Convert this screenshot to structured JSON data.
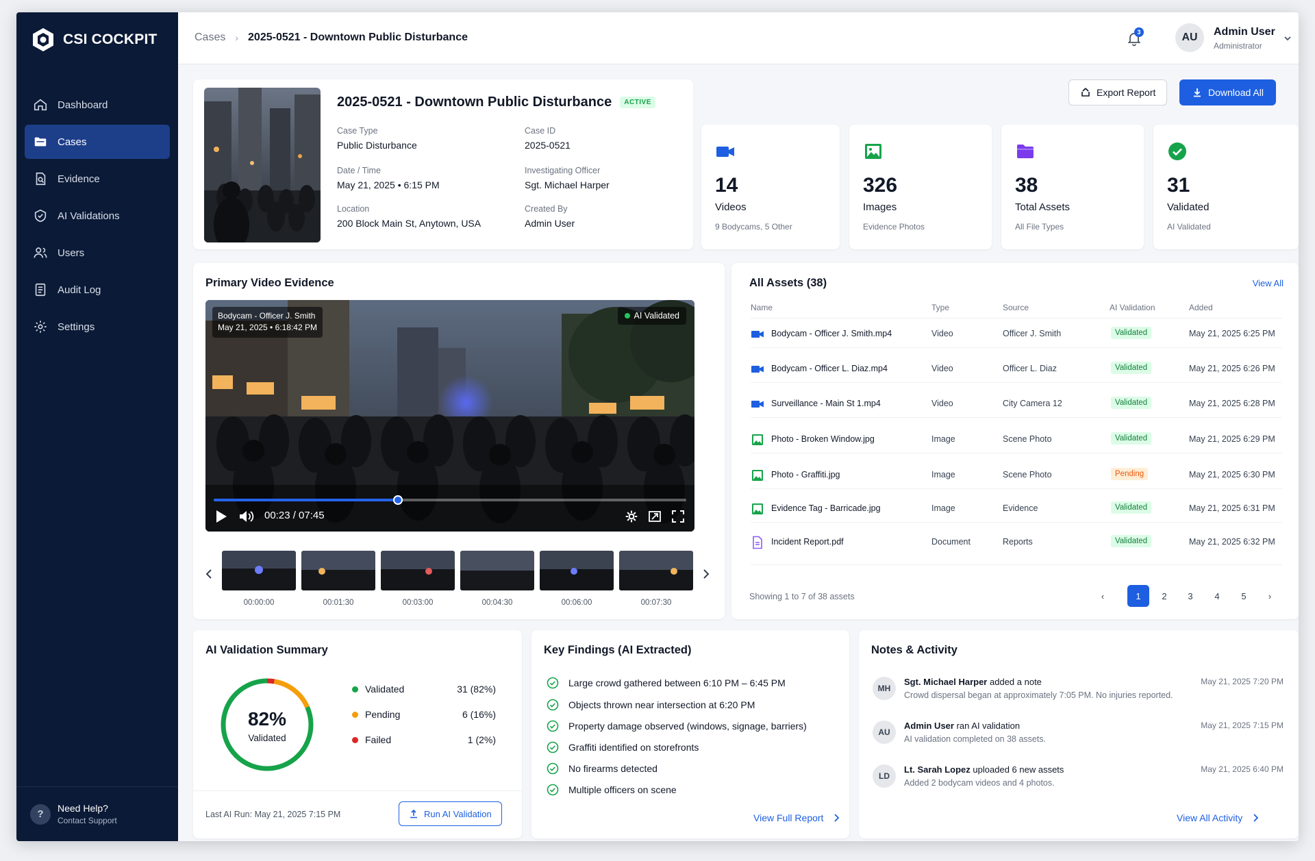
{
  "brand": {
    "name": "CSI COCKPIT"
  },
  "sidebar": {
    "items": [
      {
        "label": "Dashboard",
        "icon": "home-icon"
      },
      {
        "label": "Cases",
        "icon": "folder-icon",
        "active": true
      },
      {
        "label": "Evidence",
        "icon": "evidence-icon"
      },
      {
        "label": "AI Validations",
        "icon": "ai-validation-icon"
      },
      {
        "label": "Users",
        "icon": "users-icon"
      },
      {
        "label": "Audit Log",
        "icon": "document-icon"
      },
      {
        "label": "Settings",
        "icon": "gear-icon"
      }
    ],
    "help_title": "Need Help?",
    "help_sub": "Contact Support",
    "help_glyph": "?"
  },
  "header": {
    "crumb_root": "Cases",
    "crumb_sep": "›",
    "crumb_current": "2025-0521 - Downtown Public Disturbance",
    "notifications": "3",
    "user_initials": "AU",
    "user_name": "Admin User",
    "user_role": "Administrator"
  },
  "case": {
    "title": "2025-0521 - Downtown Public Disturbance",
    "status": "ACTIVE",
    "fields": {
      "case_type_label": "Case Type",
      "case_type": "Public Disturbance",
      "case_id_label": "Case ID",
      "case_id": "2025-0521",
      "datetime_label": "Date / Time",
      "datetime": "May 21, 2025  •  6:15 PM",
      "officer_label": "Investigating Officer",
      "officer": "Sgt. Michael Harper",
      "location_label": "Location",
      "location": "200 Block Main St, Anytown, USA",
      "created_label": "Created By",
      "created": "Admin User"
    }
  },
  "actions": {
    "export": "Export Report",
    "download": "Download All"
  },
  "stats": [
    {
      "value": "14",
      "label": "Videos",
      "sub": "9 Bodycams, 5 Other",
      "icon": "video-camera-icon",
      "color": "#1d5fe0"
    },
    {
      "value": "326",
      "label": "Images",
      "sub": "Evidence Photos",
      "icon": "image-icon",
      "color": "#16a34a"
    },
    {
      "value": "38",
      "label": "Total Assets",
      "sub": "All File Types",
      "icon": "folder-icon",
      "color": "#7c3aed"
    },
    {
      "value": "31",
      "label": "Validated",
      "sub": "AI Validated",
      "icon": "check-circle-icon",
      "color": "#16a34a"
    }
  ],
  "video": {
    "title": "Primary Video Evidence",
    "source": "Bodycam - Officer J. Smith",
    "timestamp": "May 21, 2025  •  6:18:42 PM",
    "ai_badge": "AI Validated",
    "time": "00:23 / 07:45",
    "progress": 0.39,
    "thumbs": [
      "00:00:00",
      "00:01:30",
      "00:03:00",
      "00:04:30",
      "00:06:00",
      "00:07:30"
    ]
  },
  "assets": {
    "title": "All Assets (38)",
    "view_all": "View All",
    "columns": [
      "Name",
      "Type",
      "Source",
      "AI Validation",
      "Added"
    ],
    "rows": [
      {
        "name": "Bodycam - Officer J. Smith.mp4",
        "type": "Video",
        "source": "Officer J. Smith",
        "status": "Validated",
        "added": "May 21, 2025 6:25 PM",
        "icon": "video-icon"
      },
      {
        "name": "Bodycam - Officer L. Diaz.mp4",
        "type": "Video",
        "source": "Officer L. Diaz",
        "status": "Validated",
        "added": "May 21, 2025 6:26 PM",
        "icon": "video-icon"
      },
      {
        "name": "Surveillance - Main St 1.mp4",
        "type": "Video",
        "source": "City Camera 12",
        "status": "Validated",
        "added": "May 21, 2025 6:28 PM",
        "icon": "video-icon"
      },
      {
        "name": "Photo - Broken Window.jpg",
        "type": "Image",
        "source": "Scene Photo",
        "status": "Validated",
        "added": "May 21, 2025 6:29 PM",
        "icon": "image-icon"
      },
      {
        "name": "Photo - Graffiti.jpg",
        "type": "Image",
        "source": "Scene Photo",
        "status": "Pending",
        "added": "May 21, 2025 6:30 PM",
        "icon": "image-icon"
      },
      {
        "name": "Evidence Tag - Barricade.jpg",
        "type": "Image",
        "source": "Evidence",
        "status": "Validated",
        "added": "May 21, 2025 6:31 PM",
        "icon": "image-icon"
      },
      {
        "name": "Incident Report.pdf",
        "type": "Document",
        "source": "Reports",
        "status": "Validated",
        "added": "May 21, 2025 6:32 PM",
        "icon": "document-icon"
      }
    ],
    "showing": "Showing 1 to 7 of 38 assets",
    "pages": [
      "1",
      "2",
      "3",
      "4",
      "5"
    ],
    "current_page": "1",
    "prev": "‹",
    "next": "›"
  },
  "ai_summary": {
    "title": "AI Validation Summary",
    "percent": "82%",
    "percent_label": "Validated",
    "legend": [
      {
        "label": "Validated",
        "value": "31 (82%)",
        "color": "#16a34a",
        "count": 31
      },
      {
        "label": "Pending",
        "value": "6 (16%)",
        "color": "#f59e0b",
        "count": 6
      },
      {
        "label": "Failed",
        "value": "1 (2%)",
        "color": "#dc2626",
        "count": 1
      }
    ],
    "last_run": "Last AI Run: May 21, 2025 7:15 PM",
    "run_button": "Run AI Validation"
  },
  "findings": {
    "title": "Key Findings (AI Extracted)",
    "items": [
      "Large crowd gathered between 6:10 PM – 6:45 PM",
      "Objects thrown near intersection at 6:20 PM",
      "Property damage observed (windows, signage, barriers)",
      "Graffiti identified on storefronts",
      "No firearms detected",
      "Multiple officers on scene"
    ],
    "link": "View Full Report"
  },
  "notes": {
    "title": "Notes & Activity",
    "items": [
      {
        "initials": "MH",
        "who": "Sgt. Michael Harper",
        "action": "added a note",
        "body": "Crowd dispersal began at approximately 7:05 PM. No injuries reported.",
        "time": "May 21, 2025 7:20 PM"
      },
      {
        "initials": "AU",
        "who": "Admin User",
        "action": "ran AI validation",
        "body": "AI validation completed on 38 assets.",
        "time": "May 21, 2025 7:15 PM"
      },
      {
        "initials": "LD",
        "who": "Lt. Sarah Lopez",
        "action": "uploaded 6 new assets",
        "body": "Added 2 bodycam videos and 4 photos.",
        "time": "May 21, 2025 6:40 PM"
      }
    ],
    "link": "View All Activity"
  },
  "colors": {
    "accent": "#1d5fe0",
    "sidebar": "#0b1a36",
    "success": "#16a34a",
    "warning": "#f59e0b",
    "danger": "#dc2626"
  }
}
